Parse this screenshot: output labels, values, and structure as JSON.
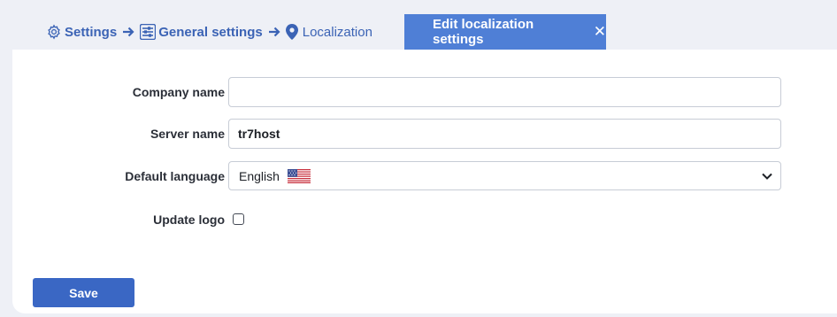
{
  "breadcrumb": {
    "items": [
      {
        "label": "Settings",
        "icon": "gear-icon"
      },
      {
        "label": "General settings",
        "icon": "sliders-icon"
      },
      {
        "label": "Localization",
        "icon": "map-pin-icon"
      }
    ],
    "separator_icon": "arrow-right-icon"
  },
  "tab": {
    "label": "Edit localization settings",
    "close_symbol": "✕"
  },
  "form": {
    "company_name": {
      "label": "Company name",
      "value": "",
      "placeholder": ""
    },
    "server_name": {
      "label": "Server name",
      "value": "tr7host"
    },
    "default_language": {
      "label": "Default language",
      "value": "English",
      "flag_icon": "us-flag-icon"
    },
    "update_logo": {
      "label": "Update logo",
      "checked": false
    }
  },
  "actions": {
    "save_label": "Save"
  },
  "colors": {
    "accent": "#4f7fd6",
    "link": "#3b63b5",
    "save_button": "#3a67c4",
    "background": "#eef0f6"
  }
}
